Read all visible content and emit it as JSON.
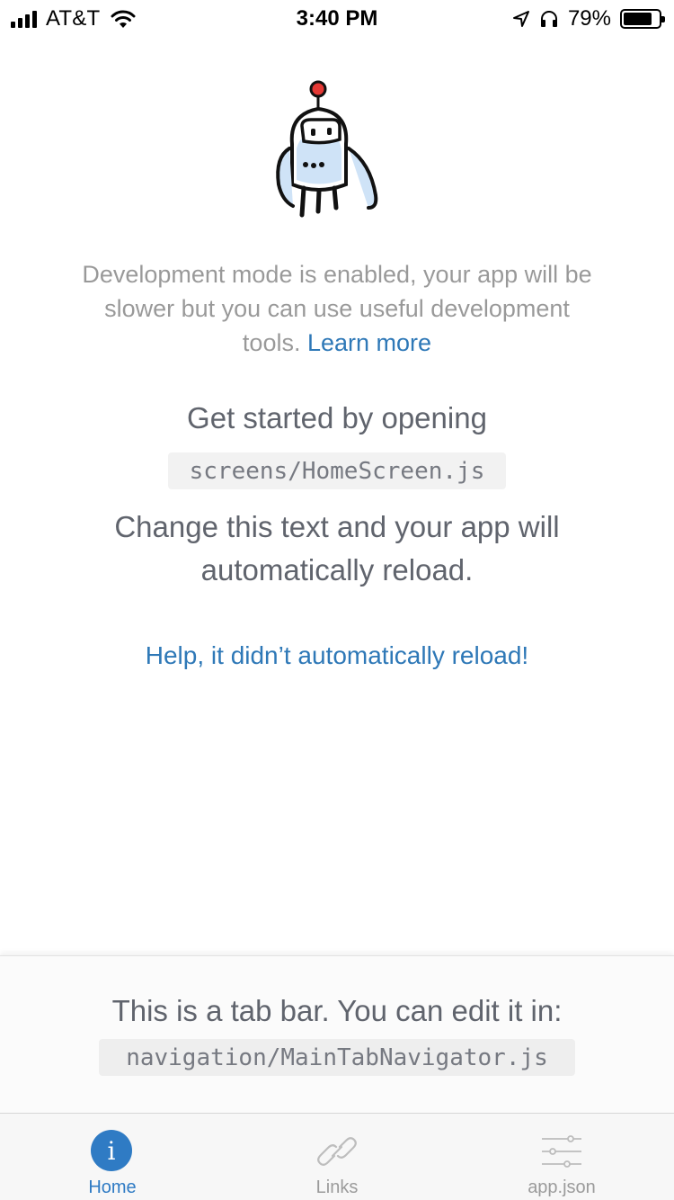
{
  "status_bar": {
    "carrier": "AT&T",
    "time": "3:40 PM",
    "battery_percent": "79%",
    "battery_level": 0.79
  },
  "main": {
    "dev_text": "Development mode is enabled, your app will be slower but you can use useful development tools.",
    "learn_more": "Learn more",
    "get_started": "Get started by opening",
    "file_path": "screens/HomeScreen.js",
    "change_text": "Change this text and your app will automatically reload.",
    "help_link": "Help, it didn’t automatically reload!"
  },
  "tab_info": {
    "text": "This is a tab bar. You can edit it in:",
    "file_path": "navigation/MainTabNavigator.js"
  },
  "tabs": [
    {
      "label": "Home",
      "icon": "info-icon",
      "active": true
    },
    {
      "label": "Links",
      "icon": "link-icon",
      "active": false
    },
    {
      "label": "app.json",
      "icon": "options-icon",
      "active": false
    }
  ],
  "colors": {
    "link": "#2e78b7",
    "tab_active": "#2f7bc4",
    "tab_inactive": "#9b9b9b"
  }
}
